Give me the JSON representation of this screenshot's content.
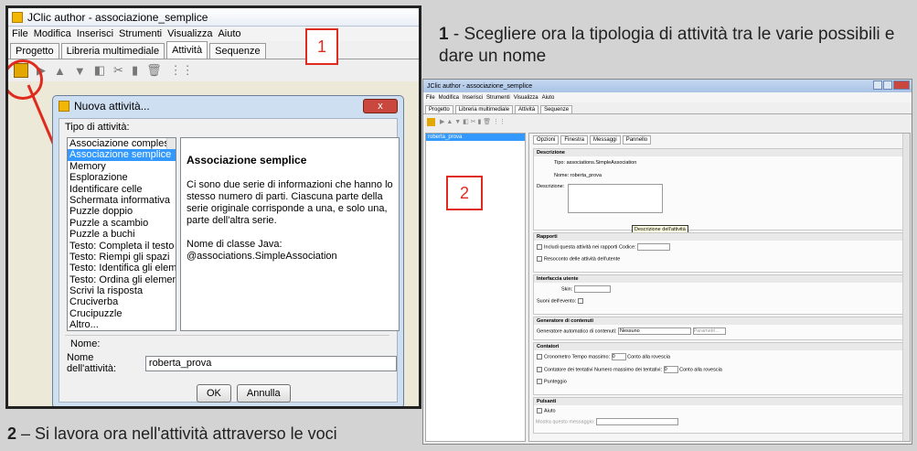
{
  "left": {
    "window_title": "JClic author - associazione_semplice",
    "menu": [
      "File",
      "Modifica",
      "Inserisci",
      "Strumenti",
      "Visualizza",
      "Aiuto"
    ],
    "tabs": [
      "Progetto",
      "Libreria multimediale",
      "Attività",
      "Sequenze"
    ],
    "toolbar_glyphs": [
      "▶",
      "▲",
      "▼",
      "◧",
      "✂",
      "▮",
      "🗑",
      "⋮⋮"
    ],
    "marker": "1",
    "dialog": {
      "title": "Nuova attività...",
      "close": "x",
      "type_label": "Tipo di attività:",
      "types": [
        "Associazione complessa",
        "Associazione semplice",
        "Memory",
        "Esplorazione",
        "Identificare celle",
        "Schermata informativa",
        "Puzzle doppio",
        "Puzzle a scambio",
        "Puzzle a buchi",
        "Testo: Completa il testo",
        "Testo: Riempi gli spazi",
        "Testo: Identifica gli elementi",
        "Testo: Ordina gli elementi",
        "Scrivi la risposta",
        "Cruciverba",
        "Crucipuzzle",
        "Altro..."
      ],
      "desc_title": "Associazione semplice",
      "desc_text": "Ci sono due serie di informazioni che hanno lo stesso numero di parti. Ciascuna parte della serie originale corrisponde a una, e solo una, parte dell'altra serie.",
      "desc_class": "Nome di classe Java: @associations.SimpleAssociation",
      "name_section": "Nome:",
      "name_label": "Nome dell'attività:",
      "name_value": "roberta_prova",
      "ok": "OK",
      "cancel": "Annulla"
    }
  },
  "caption_top": {
    "num": "1",
    "text": " - Scegliere ora la tipologia di attività tra le varie possibili e dare un nome"
  },
  "caption_bottom": {
    "num": "2",
    "text": " – Si lavora ora nell'attività attraverso le voci"
  },
  "right": {
    "window_title": "JClic author - associazione_semplice",
    "menu": [
      "File",
      "Modifica",
      "Inserisci",
      "Strumenti",
      "Visualizza",
      "Aiuto"
    ],
    "tabs": [
      "Progetto",
      "Libreria multimediale",
      "Attività",
      "Sequenze"
    ],
    "list_item": "roberta_prova",
    "marker": "2",
    "subtabs": [
      "Opzioni",
      "Finestra",
      "Messaggi",
      "Pannello"
    ],
    "descrizione": {
      "header": "Descrizione",
      "tipo_label": "Tipo:",
      "tipo_value": "associations.SimpleAssociation",
      "nome_label": "Nome:",
      "nome_value": "roberta_prova",
      "descr_label": "Descrizione:"
    },
    "tooltip": "Descrizione dell'attività",
    "rapporti": {
      "header": "Rapporti",
      "includi": "Includi questa attività nei rapporti",
      "codice": "Codice:",
      "resoconto": "Resoconto delle attività dell'utente"
    },
    "interfaccia": {
      "header": "Interfaccia utente",
      "skin": "Skin:",
      "suoni": "Suoni dell'evento:"
    },
    "generatore": {
      "header": "Generatore di contenuti",
      "label": "Generatore automatico di contenuti:",
      "value": "Nessuno",
      "btn": "Parametri..."
    },
    "contatori": {
      "header": "Contatori",
      "cronometro": "Cronometro",
      "tempo": "Tempo massimo:",
      "tentativi": "Contatore dei tentativi",
      "max_tentativi": "Numero massimo dei tentativi:",
      "conto": "Conto alla rovescia",
      "punteggio": "Punteggio",
      "zero": "0"
    },
    "pulsanti": {
      "header": "Pulsanti",
      "aiuto": "Aiuto",
      "mostra": "Mostra questo messaggio:"
    }
  }
}
